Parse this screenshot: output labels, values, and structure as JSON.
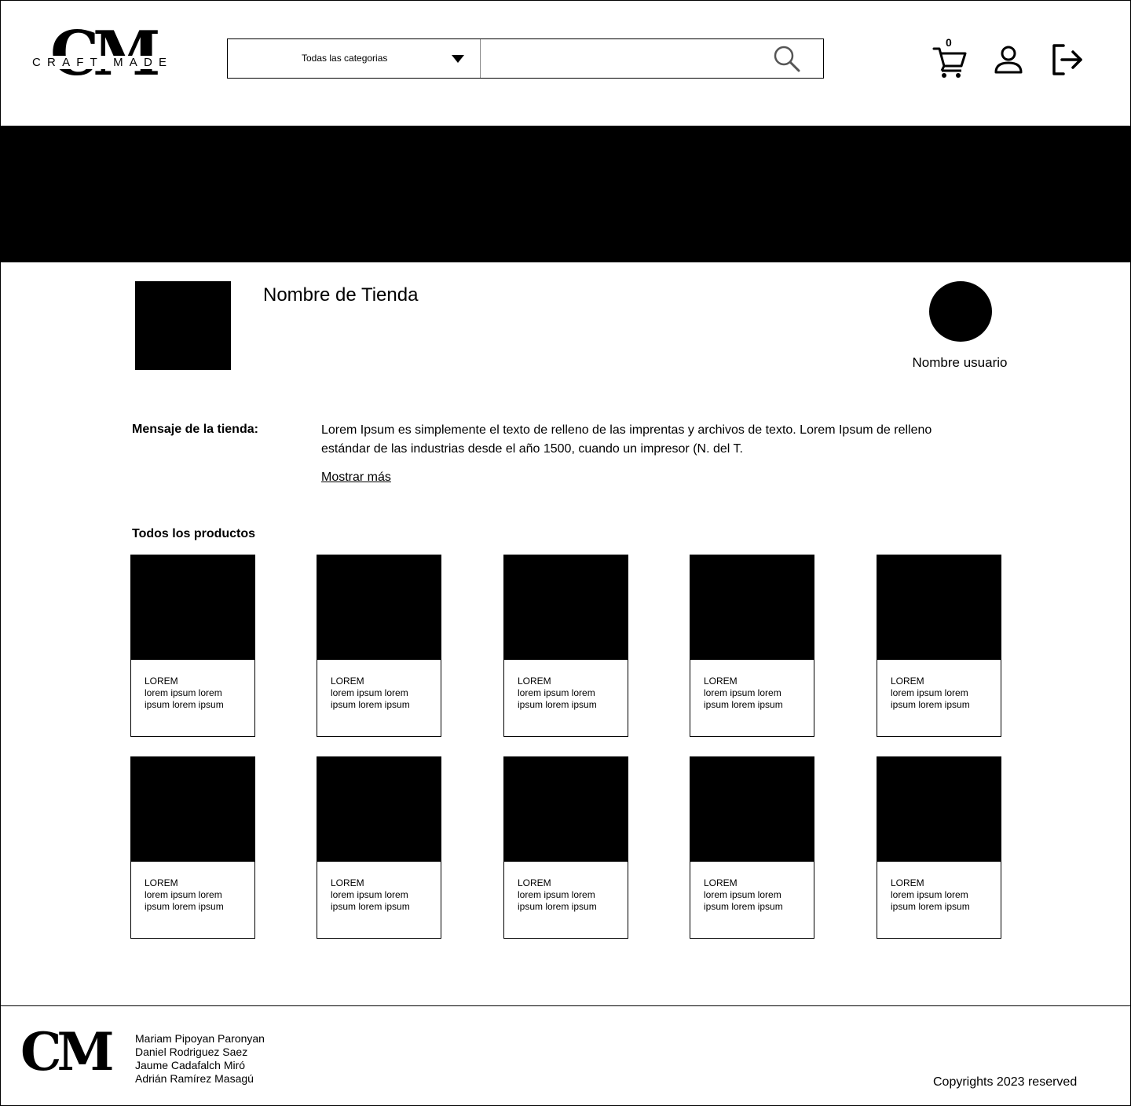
{
  "header": {
    "logo_mark": "CM",
    "logo_text": "CRAFT MADE",
    "category_select": "Todas las categorias",
    "search_placeholder": "",
    "cart_count": "0"
  },
  "shop": {
    "name": "Nombre de Tienda",
    "username": "Nombre usuario",
    "message_label": "Mensaje de la tienda:",
    "message_text": "Lorem Ipsum es simplemente el texto de relleno de las imprentas y archivos de texto. Lorem Ipsum de relleno estándar de las industrias desde el año 1500, cuando un impresor (N. del T.",
    "show_more": "Mostrar más"
  },
  "products": {
    "title": "Todos los productos",
    "items": [
      {
        "title": "LOREM",
        "desc": "lorem ipsum lorem ipsum lorem ipsum"
      },
      {
        "title": "LOREM",
        "desc": "lorem ipsum lorem ipsum lorem ipsum"
      },
      {
        "title": "LOREM",
        "desc": "lorem ipsum lorem ipsum lorem ipsum"
      },
      {
        "title": "LOREM",
        "desc": "lorem ipsum lorem ipsum lorem ipsum"
      },
      {
        "title": "LOREM",
        "desc": "lorem ipsum lorem ipsum lorem ipsum"
      },
      {
        "title": "LOREM",
        "desc": "lorem ipsum lorem ipsum lorem ipsum"
      },
      {
        "title": "LOREM",
        "desc": "lorem ipsum lorem ipsum lorem ipsum"
      },
      {
        "title": "LOREM",
        "desc": "lorem ipsum lorem ipsum lorem ipsum"
      },
      {
        "title": "LOREM",
        "desc": "lorem ipsum lorem ipsum lorem ipsum"
      },
      {
        "title": "LOREM",
        "desc": "lorem ipsum lorem ipsum lorem ipsum"
      }
    ]
  },
  "footer": {
    "logo_mark": "CM",
    "authors": [
      "Mariam Pipoyan Paronyan",
      "Daniel Rodriguez Saez",
      "Jaume Cadafalch Miró",
      "Adrián Ramírez Masagú"
    ],
    "copyright": "Copyrights 2023 reserved"
  },
  "icons": {
    "search": "search-icon",
    "cart": "cart-icon",
    "user": "user-icon",
    "logout": "logout-icon",
    "dropdown": "caret-down-icon"
  },
  "colors": {
    "primary": "#000000",
    "background": "#ffffff"
  }
}
